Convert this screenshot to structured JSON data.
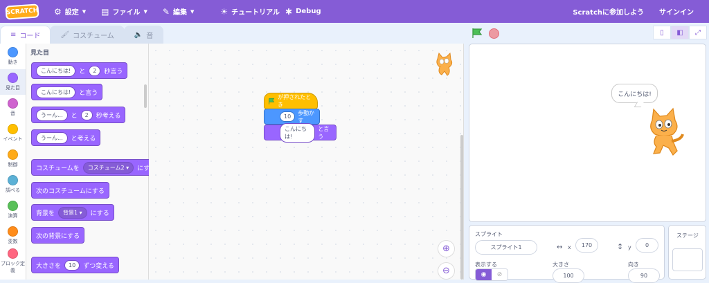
{
  "menubar": {
    "logo": "SCRATCH",
    "settings": "設定",
    "file": "ファイル",
    "edit": "編集",
    "tutorials": "チュートリアル",
    "debug": "Debug",
    "join": "Scratchに参加しよう",
    "signin": "サインイン"
  },
  "tabs": {
    "code": "コード",
    "costumes": "コスチューム",
    "sounds": "音"
  },
  "categories": [
    {
      "label": "動き",
      "color": "#4c97ff"
    },
    {
      "label": "見た目",
      "color": "#9966ff"
    },
    {
      "label": "音",
      "color": "#cf63cf"
    },
    {
      "label": "イベント",
      "color": "#ffbf00"
    },
    {
      "label": "制御",
      "color": "#ffab19"
    },
    {
      "label": "調べる",
      "color": "#5cb1d6"
    },
    {
      "label": "演算",
      "color": "#59c059"
    },
    {
      "label": "変数",
      "color": "#ff8c1a"
    },
    {
      "label": "ブロック定義",
      "color": "#ff6680"
    }
  ],
  "flyout": {
    "title": "見た目",
    "say_for": {
      "text": "こんにちは!",
      "and": "と",
      "secs": "2",
      "suffix": "秒言う"
    },
    "say": {
      "text": "こんにちは!",
      "suffix": "と言う"
    },
    "think_for": {
      "text": "うーん...",
      "and": "と",
      "secs": "2",
      "suffix": "秒考える"
    },
    "think": {
      "text": "うーん...",
      "suffix": "と考える"
    },
    "switch_costume": {
      "prefix": "コスチュームを",
      "value": "コスチューム2 ▾",
      "suffix": "にする"
    },
    "next_costume": "次のコスチュームにする",
    "switch_backdrop": {
      "prefix": "背景を",
      "value": "背景1 ▾",
      "suffix": "にする"
    },
    "next_backdrop": "次の背景にする",
    "change_size": {
      "prefix": "大きさを",
      "value": "10",
      "suffix": "ずつ変える"
    }
  },
  "script": {
    "hat": "が押されたとき",
    "move_value": "10",
    "move_label": "歩動かす",
    "say_text": "こんにちは!",
    "say_label": "と言う"
  },
  "stage": {
    "bubble": "こんにちは!"
  },
  "sprite_info": {
    "label": "スプライト",
    "name": "スプライト1",
    "x_label": "x",
    "x": "170",
    "y_label": "y",
    "y": "0",
    "show_label": "表示する",
    "size_label": "大きさ",
    "size": "100",
    "direction_label": "向き",
    "direction": "90"
  },
  "stage_panel": {
    "label": "ステージ"
  }
}
